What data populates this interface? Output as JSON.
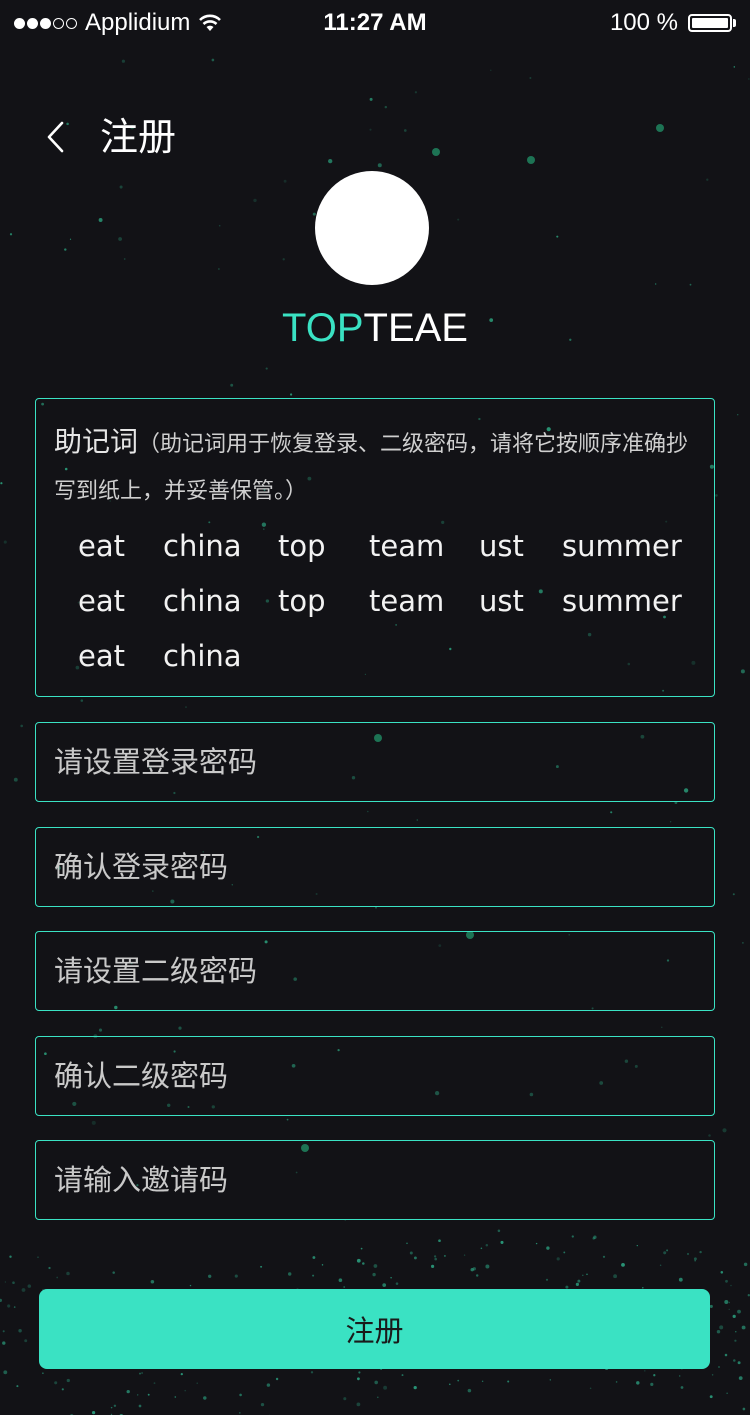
{
  "status_bar": {
    "carrier": "Applidium",
    "time": "11:27 AM",
    "battery": "100 %",
    "battery_level": 1.0,
    "signal_bars_filled": 3,
    "signal_bars_total": 5
  },
  "header": {
    "back_icon": "chevron-left-icon",
    "title": "注册"
  },
  "brand": {
    "accent": "TOP",
    "rest": "TEAE",
    "accent_color": "#3ae2c3"
  },
  "mnemonic": {
    "title": "助记词",
    "note": "（助记词用于恢复登录、二级密码，请将它按顺序准确抄写到纸上，并妥善保管。）",
    "words": [
      "eat",
      "china",
      "top",
      "team",
      "ust",
      "summer",
      "eat",
      "china",
      "top",
      "team",
      "ust",
      "summer",
      "eat",
      "china"
    ]
  },
  "form": {
    "login_password_placeholder": "请设置登录密码",
    "confirm_login_password_placeholder": "确认登录密码",
    "secondary_password_placeholder": "请设置二级密码",
    "confirm_secondary_password_placeholder": "确认二级密码",
    "invite_code_placeholder": "请输入邀请码"
  },
  "submit_label": "注册",
  "colors": {
    "background": "#121216",
    "accent": "#3ae2c3"
  }
}
